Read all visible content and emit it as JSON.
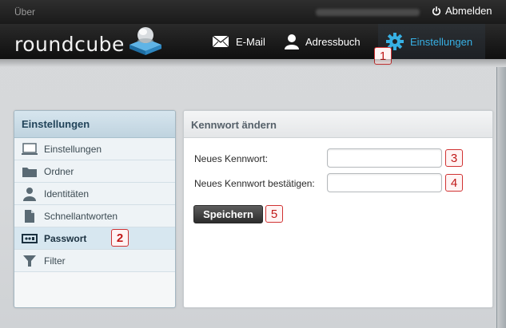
{
  "topbar": {
    "about_label": "Über",
    "logout_label": "Abmelden"
  },
  "header": {
    "logo_text": "roundcube",
    "nav": {
      "mail_label": "E-Mail",
      "addressbook_label": "Adressbuch",
      "settings_label": "Einstellungen"
    }
  },
  "sidebar": {
    "title": "Einstellungen",
    "items": [
      {
        "label": "Einstellungen",
        "icon": "monitor-icon"
      },
      {
        "label": "Ordner",
        "icon": "folder-icon"
      },
      {
        "label": "Identitäten",
        "icon": "person-icon"
      },
      {
        "label": "Schnellantworten",
        "icon": "document-icon"
      },
      {
        "label": "Passwort",
        "icon": "key-card-icon",
        "selected": true
      },
      {
        "label": "Filter",
        "icon": "funnel-icon"
      }
    ]
  },
  "content": {
    "title": "Kennwort ändern",
    "new_password_label": "Neues Kennwort:",
    "new_password_value": "",
    "confirm_password_label": "Neues Kennwort bestätigen:",
    "confirm_password_value": "",
    "save_label": "Speichern"
  },
  "annotations": {
    "m1": "1",
    "m2": "2",
    "m3": "3",
    "m4": "4",
    "m5": "5"
  },
  "colors": {
    "accent_blue": "#37b0e4",
    "marker_red": "#d03232",
    "sidebar_header": "#c9dce7"
  }
}
